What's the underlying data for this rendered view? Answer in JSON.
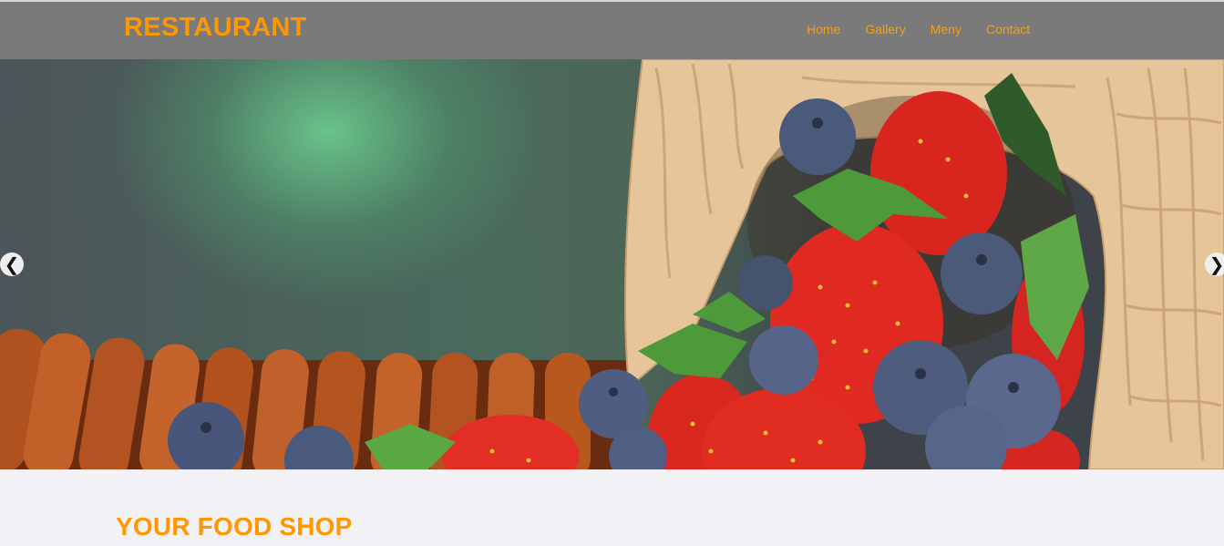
{
  "brand": "RESTAURANT",
  "nav": [
    {
      "label": "Home"
    },
    {
      "label": "Gallery"
    },
    {
      "label": "Meny"
    },
    {
      "label": "Contact"
    }
  ],
  "carousel": {
    "prev_icon": "chevron-left-icon",
    "next_icon": "chevron-right-icon",
    "prev_glyph": "❮",
    "next_glyph": "❯"
  },
  "section": {
    "title": "YOUR FOOD SHOP"
  },
  "colors": {
    "accent": "#ff9800",
    "navbar": "#7a7a7a",
    "page_bg": "#f2f1f5"
  }
}
